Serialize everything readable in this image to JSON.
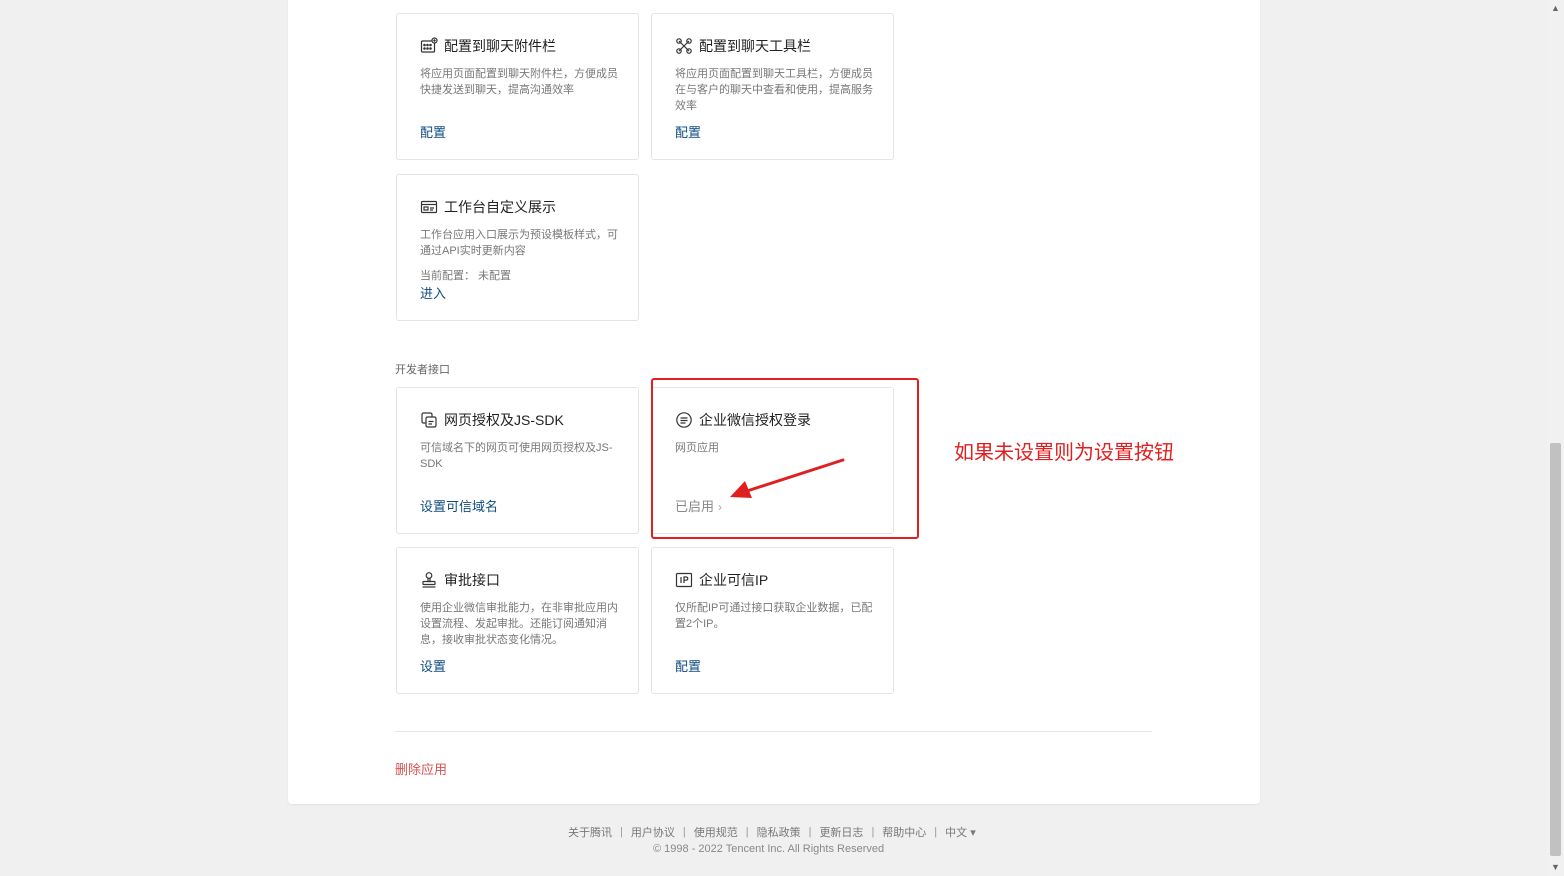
{
  "cards": [
    {
      "title": "配置到聊天附件栏",
      "desc": "将应用页面配置到聊天附件栏，方便成员快捷发送到聊天，提高沟通效率",
      "action": "配置"
    },
    {
      "title": "配置到聊天工具栏",
      "desc": "将应用页面配置到聊天工具栏，方便成员在与客户的聊天中查看和使用，提高服务效率",
      "action": "配置"
    },
    {
      "title": "工作台自定义展示",
      "desc": "工作台应用入口展示为预设模板样式，可通过API实时更新内容",
      "extra": "当前配置： 未配置",
      "action": "进入"
    }
  ],
  "dev_section": {
    "label": "开发者接口",
    "cards": [
      {
        "title": "网页授权及JS-SDK",
        "desc": "可信域名下的网页可使用网页授权及JS-SDK",
        "action": "设置可信域名"
      },
      {
        "title": "企业微信授权登录",
        "desc": "网页应用",
        "action": "已启用"
      },
      {
        "title": "审批接口",
        "desc": "使用企业微信审批能力，在非审批应用内设置流程、发起审批。还能订阅通知消息，接收审批状态变化情况。",
        "action": "设置"
      },
      {
        "title": "企业可信IP",
        "desc": "仅所配IP可通过接口获取企业数据，已配置2个IP。",
        "action": "配置"
      }
    ]
  },
  "delete_label": "删除应用",
  "annotation": {
    "text": "如果未设置则为设置按钮",
    "color": "#e02020"
  },
  "footer": {
    "links": [
      "关于腾讯",
      "用户协议",
      "使用规范",
      "隐私政策",
      "更新日志",
      "帮助中心"
    ],
    "language": "中文 ▾",
    "copyright": "© 1998 - 2022 Tencent Inc. All Rights Reserved"
  }
}
